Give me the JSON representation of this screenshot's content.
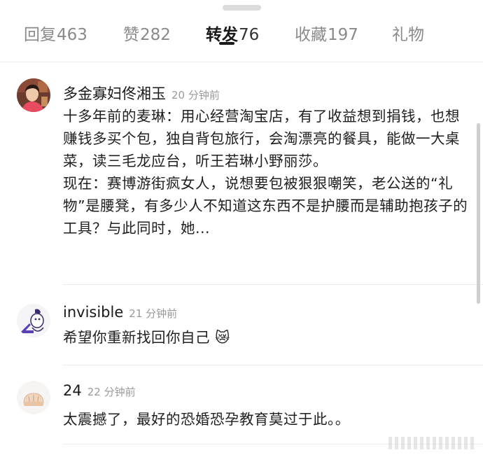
{
  "tabs": [
    {
      "label": "回复",
      "count": "463",
      "active": false
    },
    {
      "label": "赞",
      "count": "282",
      "active": false
    },
    {
      "label": "转发",
      "count": "76",
      "active": true
    },
    {
      "label": "收藏",
      "count": "197",
      "active": false
    },
    {
      "label": "礼物",
      "count": "",
      "active": false
    }
  ],
  "comments": [
    {
      "username": "多金寡妇佟湘玉",
      "time": "20 分钟前",
      "avatar_icon": "user-photo-avatar",
      "paragraphs": [
        "十多年前的麦琳：用心经营淘宝店，有了收益想到捐钱，也想赚钱多买个包，独自背包旅行，会淘漂亮的餐具，能做一大桌菜，读三毛龙应台，听王若琳小野丽莎。",
        "现在：赛博游街疯女人，说想要包被狠狠嘲笑，老公送的“礼物”是腰凳，有多少人不知道这东西不是护腰而是辅助抱孩子的工具？与此同时，她..."
      ]
    },
    {
      "username": "invisible",
      "time": "21 分钟前",
      "avatar_icon": "cartoon-laptop-avatar",
      "paragraphs": [
        "希望你重新找回你自己"
      ],
      "emoji": "😿"
    },
    {
      "username": "24",
      "time": "22 分钟前",
      "avatar_icon": "bread-avatar",
      "paragraphs": [
        "太震撼了，最好的恐婚恐孕教育莫过于此。。"
      ]
    }
  ]
}
